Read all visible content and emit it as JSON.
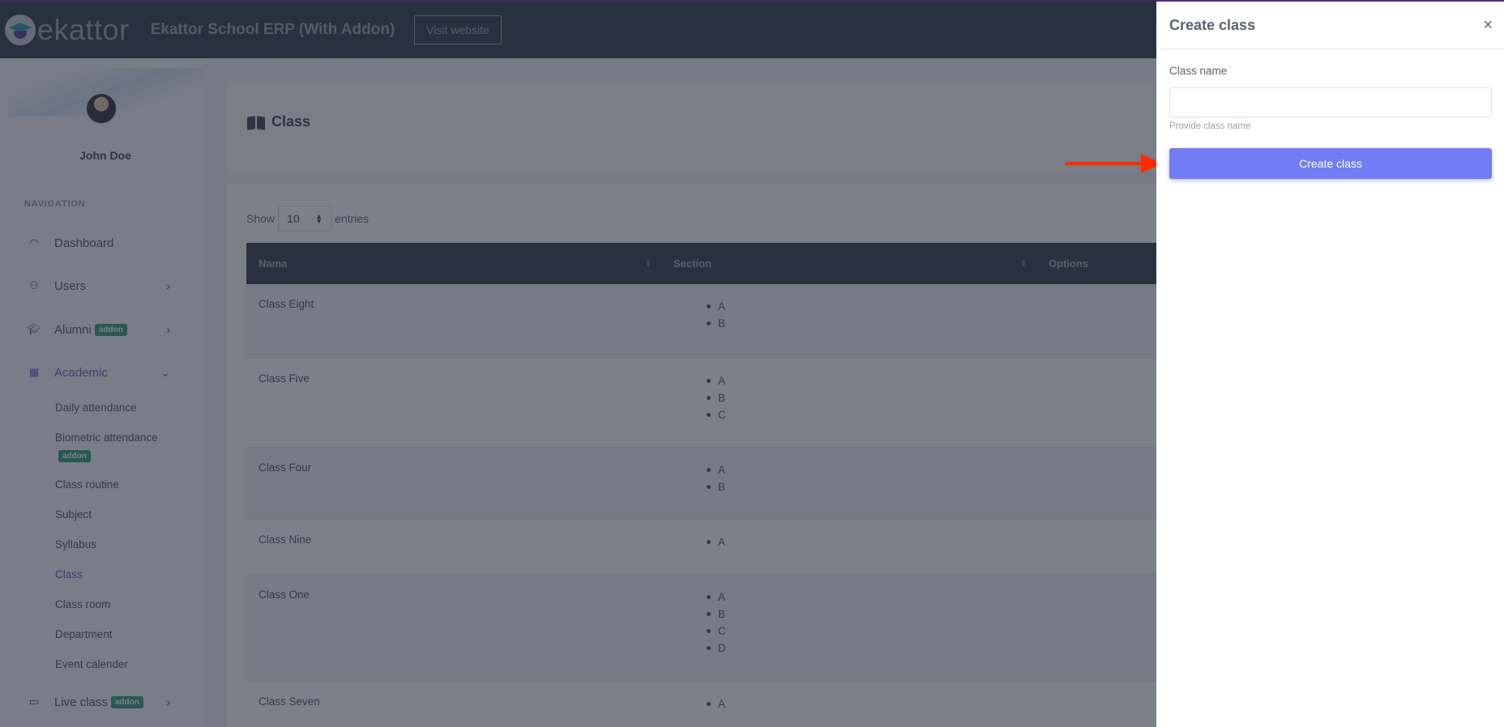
{
  "topbar": {
    "logo_text": "ekattor",
    "app_title": "Ekattor School ERP (With Addon)",
    "visit_button": "Visit website"
  },
  "sidebar": {
    "user_name": "John Doe",
    "nav_title": "NAVIGATION",
    "items": [
      {
        "label": "Dashboard",
        "icon": "dashboard-icon"
      },
      {
        "label": "Users",
        "icon": "user-icon"
      },
      {
        "label": "Alumni",
        "icon": "graduation-cap-icon",
        "badge": "addon"
      },
      {
        "label": "Academic",
        "icon": "school-icon",
        "active": true
      },
      {
        "label": "Live class",
        "icon": "video-icon",
        "badge": "addon"
      }
    ],
    "academic_sub": [
      {
        "label": "Daily attendance"
      },
      {
        "label": "Biometric attendance",
        "badge": "addon"
      },
      {
        "label": "Class routine"
      },
      {
        "label": "Subject"
      },
      {
        "label": "Syllabus"
      },
      {
        "label": "Class",
        "active": true
      },
      {
        "label": "Class room"
      },
      {
        "label": "Department"
      },
      {
        "label": "Event calender"
      }
    ]
  },
  "main": {
    "page_title": "Class",
    "show_label": "Show",
    "entries_value": "10",
    "entries_label": "entries",
    "columns": [
      "Nama",
      "Section",
      "Options"
    ],
    "rows": [
      {
        "name": "Class Eight",
        "sections": [
          "A",
          "B"
        ]
      },
      {
        "name": "Class Five",
        "sections": [
          "A",
          "B",
          "C"
        ]
      },
      {
        "name": "Class Four",
        "sections": [
          "A",
          "B"
        ]
      },
      {
        "name": "Class Nine",
        "sections": [
          "A"
        ]
      },
      {
        "name": "Class One",
        "sections": [
          "A",
          "B",
          "C",
          "D"
        ]
      },
      {
        "name": "Class Seven",
        "sections": [
          "A"
        ]
      }
    ]
  },
  "panel": {
    "title": "Create class",
    "close": "×",
    "field_label": "Class name",
    "field_value": "",
    "field_help": "Provide class name",
    "submit": "Create class"
  },
  "colors": {
    "accent": "#727cf5",
    "topbar": "#313a4c",
    "addon_badge": "#2a9d74",
    "annotation_arrow": "#ff2a00"
  }
}
